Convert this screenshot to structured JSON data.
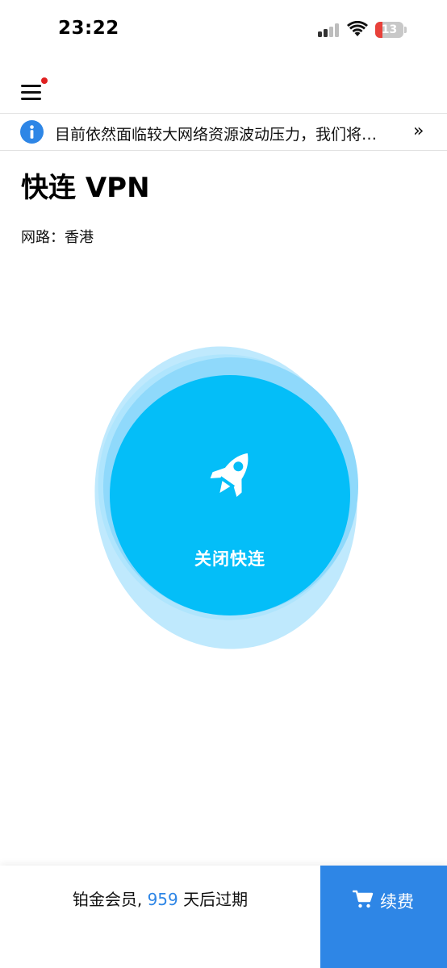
{
  "status_bar": {
    "time": "23:22",
    "battery_level": "13",
    "battery_color": "#e8413a"
  },
  "header": {
    "menu_icon": "hamburger-menu-icon",
    "has_badge": true,
    "badge_color": "#e02020"
  },
  "notice": {
    "icon": "info-icon",
    "text": "目前依然面临较大网络资源波动压力，我们将…",
    "arrow": "»"
  },
  "main": {
    "title": "快连 VPN",
    "route_text": "网路：香港",
    "connect_button": {
      "icon": "rocket-icon",
      "label": "关闭快连",
      "color": "#04bef8"
    }
  },
  "footer": {
    "membership_prefix": "铂金会员, ",
    "days": "959",
    "membership_suffix": " 天后过期",
    "renew_icon": "shopping-cart-icon",
    "renew_label": "续费",
    "accent_color": "#2e86e6"
  }
}
